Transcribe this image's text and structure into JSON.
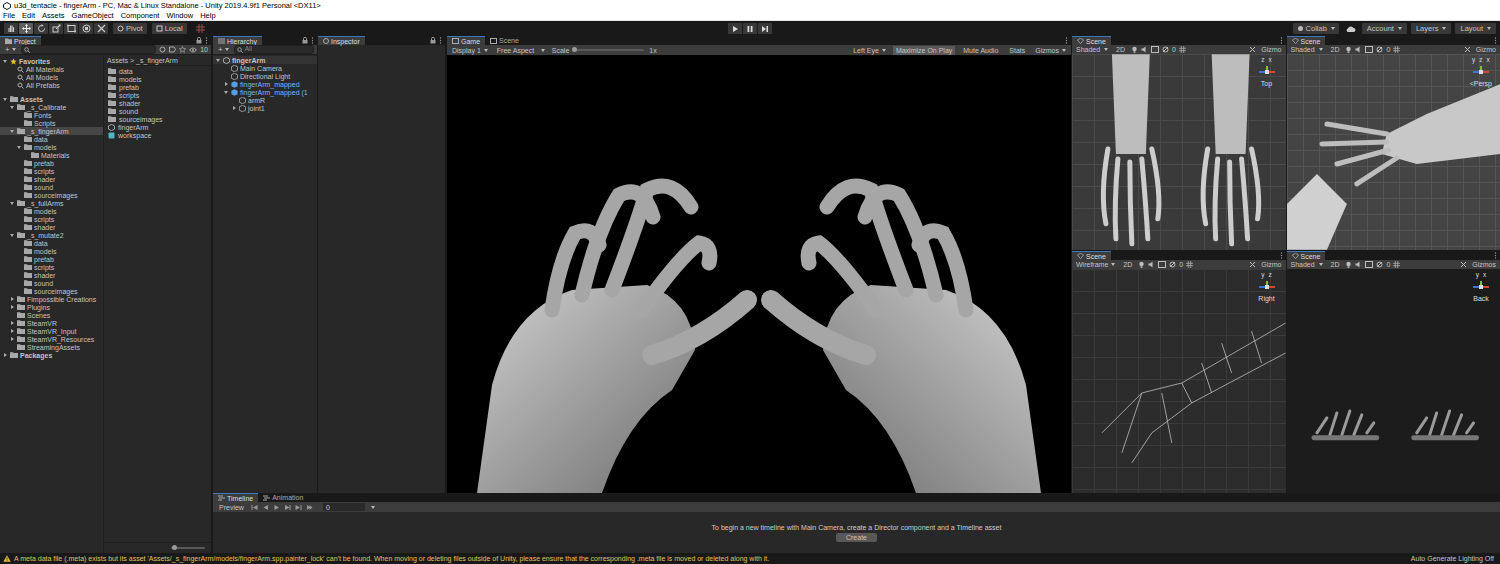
{
  "window": {
    "title": "u3d_tentacle - fingerArm - PC, Mac & Linux Standalone - Unity 2019.4.9f1 Personal <DX11>"
  },
  "menu": [
    "File",
    "Edit",
    "Assets",
    "GameObject",
    "Component",
    "Window",
    "Help"
  ],
  "toolbar": {
    "tools": [
      {
        "kind": "hand",
        "selected": false
      },
      {
        "kind": "move",
        "selected": true
      },
      {
        "kind": "rotate",
        "selected": false
      },
      {
        "kind": "scale",
        "selected": false
      },
      {
        "kind": "rect",
        "selected": false
      },
      {
        "kind": "transform",
        "selected": false
      },
      {
        "kind": "custom",
        "selected": false
      }
    ],
    "pivot": "Pivot",
    "space": "Local",
    "playback": [
      {
        "kind": "play",
        "selected": false
      },
      {
        "kind": "pause",
        "selected": false
      },
      {
        "kind": "step",
        "selected": false
      }
    ],
    "collab": "Collab",
    "account": "Account",
    "layers": "Layers",
    "layout": "Layout"
  },
  "project": {
    "tab": "Project",
    "add": "+",
    "count": "10",
    "tree": [
      {
        "label": "Favorites",
        "kind": "favorites",
        "expandable": true,
        "expanded": true,
        "selected": false,
        "children": [
          {
            "label": "All Materials",
            "kind": "search",
            "expandable": false,
            "expanded": false,
            "selected": false,
            "children": []
          },
          {
            "label": "All Models",
            "kind": "search",
            "expandable": false,
            "expanded": false,
            "selected": false,
            "children": []
          },
          {
            "label": "All Prefabs",
            "kind": "search",
            "expandable": false,
            "expanded": false,
            "selected": false,
            "children": []
          }
        ]
      },
      {
        "label": "Assets",
        "kind": "folder",
        "expandable": true,
        "expanded": true,
        "selected": false,
        "children": [
          {
            "label": "_s_Calibrate",
            "kind": "folder",
            "expandable": true,
            "expanded": true,
            "selected": false,
            "children": [
              {
                "label": "Fonts",
                "kind": "folder",
                "expandable": false,
                "expanded": false,
                "selected": false,
                "children": []
              },
              {
                "label": "Scripts",
                "kind": "folder",
                "expandable": false,
                "expanded": false,
                "selected": false,
                "children": []
              }
            ]
          },
          {
            "label": "_s_fingerArm",
            "kind": "folder",
            "expandable": true,
            "expanded": true,
            "selected": true,
            "children": [
              {
                "label": "data",
                "kind": "folder",
                "expandable": false,
                "expanded": false,
                "selected": false,
                "children": []
              },
              {
                "label": "models",
                "kind": "folder",
                "expandable": true,
                "expanded": true,
                "selected": false,
                "children": [
                  {
                    "label": "Materials",
                    "kind": "folder",
                    "expandable": false,
                    "expanded": false,
                    "selected": false,
                    "children": []
                  }
                ]
              },
              {
                "label": "prefab",
                "kind": "folder",
                "expandable": false,
                "expanded": false,
                "selected": false,
                "children": []
              },
              {
                "label": "scripts",
                "kind": "folder",
                "expandable": false,
                "expanded": false,
                "selected": false,
                "children": []
              },
              {
                "label": "shader",
                "kind": "folder",
                "expandable": false,
                "expanded": false,
                "selected": false,
                "children": []
              },
              {
                "label": "sound",
                "kind": "folder",
                "expandable": false,
                "expanded": false,
                "selected": false,
                "children": []
              },
              {
                "label": "sourceimages",
                "kind": "folder",
                "expandable": false,
                "expanded": false,
                "selected": false,
                "children": []
              }
            ]
          },
          {
            "label": "_s_fullArms",
            "kind": "folder",
            "expandable": true,
            "expanded": true,
            "selected": false,
            "children": [
              {
                "label": "models",
                "kind": "folder",
                "expandable": false,
                "expanded": false,
                "selected": false,
                "children": []
              },
              {
                "label": "scripts",
                "kind": "folder",
                "expandable": false,
                "expanded": false,
                "selected": false,
                "children": []
              },
              {
                "label": "shader",
                "kind": "folder",
                "expandable": false,
                "expanded": false,
                "selected": false,
                "children": []
              }
            ]
          },
          {
            "label": "_s_mutate2",
            "kind": "folder",
            "expandable": true,
            "expanded": true,
            "selected": false,
            "children": [
              {
                "label": "data",
                "kind": "folder",
                "expandable": false,
                "expanded": false,
                "selected": false,
                "children": []
              },
              {
                "label": "models",
                "kind": "folder",
                "expandable": false,
                "expanded": false,
                "selected": false,
                "children": []
              },
              {
                "label": "prefab",
                "kind": "folder",
                "expandable": false,
                "expanded": false,
                "selected": false,
                "children": []
              },
              {
                "label": "scripts",
                "kind": "folder",
                "expandable": false,
                "expanded": false,
                "selected": false,
                "children": []
              },
              {
                "label": "shader",
                "kind": "folder",
                "expandable": false,
                "expanded": false,
                "selected": false,
                "children": []
              },
              {
                "label": "sound",
                "kind": "folder",
                "expandable": false,
                "expanded": false,
                "selected": false,
                "children": []
              },
              {
                "label": "sourceimages",
                "kind": "folder",
                "expandable": false,
                "expanded": false,
                "selected": false,
                "children": []
              }
            ]
          },
          {
            "label": "Fimpossible Creations",
            "kind": "folder",
            "expandable": true,
            "expanded": false,
            "selected": false,
            "children": []
          },
          {
            "label": "Plugins",
            "kind": "folder",
            "expandable": true,
            "expanded": false,
            "selected": false,
            "children": []
          },
          {
            "label": "Scenes",
            "kind": "folder",
            "expandable": false,
            "expanded": false,
            "selected": false,
            "children": []
          },
          {
            "label": "SteamVR",
            "kind": "folder",
            "expandable": true,
            "expanded": false,
            "selected": false,
            "children": []
          },
          {
            "label": "SteamVR_Input",
            "kind": "folder",
            "expandable": true,
            "expanded": false,
            "selected": false,
            "children": []
          },
          {
            "label": "SteamVR_Resources",
            "kind": "folder",
            "expandable": true,
            "expanded": false,
            "selected": false,
            "children": []
          },
          {
            "label": "StreamingAssets",
            "kind": "folder",
            "expandable": false,
            "expanded": false,
            "selected": false,
            "children": []
          }
        ]
      },
      {
        "label": "Packages",
        "kind": "folder",
        "expandable": true,
        "expanded": false,
        "selected": false,
        "children": []
      }
    ],
    "breadcrumb": [
      "Assets",
      "_s_fingerArm"
    ],
    "separator": ">",
    "items": [
      {
        "label": "data",
        "kind": "folder"
      },
      {
        "label": "models",
        "kind": "folder"
      },
      {
        "label": "prefab",
        "kind": "folder"
      },
      {
        "label": "scripts",
        "kind": "folder"
      },
      {
        "label": "shader",
        "kind": "folder"
      },
      {
        "label": "sound",
        "kind": "folder"
      },
      {
        "label": "sourceimages",
        "kind": "folder"
      },
      {
        "label": "fingerArm",
        "kind": "scene"
      },
      {
        "label": "workspace",
        "kind": "asset"
      }
    ],
    "icon_size": {
      "level": 0.1
    }
  },
  "hierarchy": {
    "tab": "Hierarchy",
    "add": "+",
    "search_placeholder": "All",
    "tree": [
      {
        "label": "fingerArm",
        "kind": "scene",
        "expandable": true,
        "expanded": true,
        "selected": false,
        "children": [
          {
            "label": "Main Camera",
            "kind": "object",
            "expandable": false,
            "expanded": false,
            "selected": false,
            "children": []
          },
          {
            "label": "Directional Light",
            "kind": "object",
            "expandable": false,
            "expanded": false,
            "selected": false,
            "children": []
          },
          {
            "label": "fingerArm_mapped",
            "kind": "prefab",
            "expandable": true,
            "expanded": false,
            "selected": false,
            "children": []
          },
          {
            "label": "fingerArm_mapped (1",
            "kind": "prefab",
            "expandable": true,
            "expanded": true,
            "selected": false,
            "children": [
              {
                "label": "armR",
                "kind": "object",
                "expandable": false,
                "expanded": false,
                "selected": false,
                "children": []
              },
              {
                "label": "joint1",
                "kind": "object",
                "expandable": true,
                "expanded": false,
                "selected": false,
                "children": []
              }
            ]
          }
        ]
      }
    ]
  },
  "inspector": {
    "tab": "Inspector"
  },
  "game": {
    "tabs": [
      {
        "label": "Game",
        "selected": true
      },
      {
        "label": "Scene",
        "selected": false
      }
    ],
    "display": "Display 1",
    "aspect": "Free Aspect",
    "scale_label": "Scale",
    "scale": {
      "level": 0.0
    },
    "scale_reading": "1x",
    "eye": "Left Eye",
    "toggles": [
      {
        "label": "Maximize On Play",
        "selected": true
      },
      {
        "label": "Mute Audio",
        "selected": false
      },
      {
        "label": "Stats",
        "selected": false
      }
    ],
    "gizmos": "Gizmos"
  },
  "scene_views": [
    {
      "tab": "Scene",
      "mode": "Shaded",
      "toggle_2d": "2D",
      "count": "0",
      "gizmos": "Gizmo",
      "view": "Top",
      "axes": [
        "z",
        "x"
      ],
      "kind": "top"
    },
    {
      "tab": "Scene",
      "mode": "Shaded",
      "toggle_2d": "2D",
      "count": "0",
      "gizmos": "Gizmo",
      "view": "<Persp",
      "axes": [
        "y",
        "z",
        "x"
      ],
      "kind": "persp"
    },
    {
      "tab": "Scene",
      "mode": "Wireframe",
      "toggle_2d": "2D",
      "count": "0",
      "gizmos": "Gizmo",
      "view": "Right",
      "axes": [
        "y",
        "z"
      ],
      "kind": "wireframe"
    },
    {
      "tab": "Scene",
      "mode": "Shaded",
      "toggle_2d": "2D",
      "count": "0",
      "gizmos": "Gizmos",
      "view": "Back",
      "axes": [
        "y",
        "x"
      ],
      "kind": "back"
    }
  ],
  "timeline": {
    "tabs": [
      {
        "label": "Timeline",
        "selected": true
      },
      {
        "label": "Animation",
        "selected": false
      }
    ],
    "preview": "Preview",
    "frame": "0",
    "message": "To begin a new timeline with Main Camera, create a Director component and a Timeline asset",
    "create": "Create"
  },
  "status_bar": {
    "warning": "A meta data file (.meta) exists but its asset 'Assets/_s_fingerArm/models/fingerArm.spp.painter_lock' can't be found. When moving or deleting files outside of Unity, please ensure that the corresponding .meta file is moved or deleted along with it.",
    "lighting": "Auto Generate Lighting Off"
  }
}
